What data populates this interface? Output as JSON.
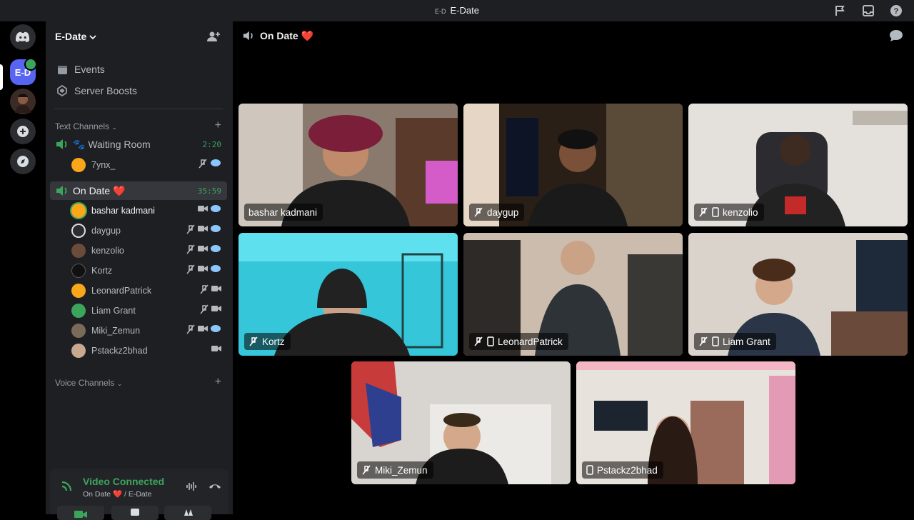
{
  "titlebar": {
    "badge": "E-D",
    "title": "E-Date"
  },
  "rail": {
    "server_badge": "E-D"
  },
  "sidebar": {
    "guild_name": "E-Date",
    "top_items": [
      {
        "label": "Events"
      },
      {
        "label": "Server Boosts"
      }
    ],
    "text_channels_label": "Text Channels",
    "voice_channels_label": "Voice Channels",
    "waiting_room": {
      "label": "🐾 Waiting Room",
      "timer": "2:20",
      "members": [
        {
          "name": "7ynx_"
        }
      ]
    },
    "on_date": {
      "label": "On Date ❤️",
      "timer": "35:59",
      "members": [
        {
          "name": "bashar kadmani"
        },
        {
          "name": "daygup"
        },
        {
          "name": "kenzolio"
        },
        {
          "name": "Kortz"
        },
        {
          "name": "LeonardPatrick"
        },
        {
          "name": "Liam Grant"
        },
        {
          "name": "Miki_Zemun"
        },
        {
          "name": "Pstackz2bhad"
        }
      ]
    }
  },
  "voice_connection": {
    "status": "Video Connected",
    "location": "On Date ❤️ / E-Date"
  },
  "main": {
    "channel_title": "On Date ❤️"
  },
  "tiles": [
    {
      "name": "bashar kadmani"
    },
    {
      "name": "daygup"
    },
    {
      "name": "kenzolio"
    },
    {
      "name": "Kortz"
    },
    {
      "name": "LeonardPatrick"
    },
    {
      "name": "Liam Grant"
    },
    {
      "name": "Miki_Zemun"
    },
    {
      "name": "Pstackz2bhad"
    }
  ],
  "colors": {
    "accent": "#5865f2",
    "connected": "#3ba55c",
    "sidebar": "#1e1f22"
  }
}
